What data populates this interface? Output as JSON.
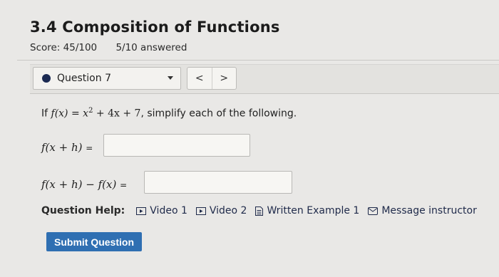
{
  "header": {
    "title": "3.4 Composition of Functions",
    "score": "Score: 45/100",
    "answered": "5/10 answered"
  },
  "question_nav": {
    "selected": "Question 7",
    "prev_label": "<",
    "next_label": ">"
  },
  "problem": {
    "prefix": "If ",
    "function_lhs": "f(x)",
    "equals": " = ",
    "function_rhs_part1": "x",
    "exponent": "2",
    "function_rhs_part2": " + 4x + 7",
    "suffix": ", simplify each of the following."
  },
  "parts": [
    {
      "expr": "f(x + h)",
      "equals": "=",
      "answer": ""
    },
    {
      "expr": "f(x + h) − f(x)",
      "equals": "=",
      "answer": ""
    }
  ],
  "help": {
    "label": "Question Help:",
    "items": [
      {
        "label": "Video 1",
        "icon": "play-icon"
      },
      {
        "label": "Video 2",
        "icon": "play-icon"
      },
      {
        "label": "Written Example 1",
        "icon": "document-icon"
      },
      {
        "label": "Message instructor",
        "icon": "envelope-icon"
      }
    ]
  },
  "submit_label": "Submit Question"
}
